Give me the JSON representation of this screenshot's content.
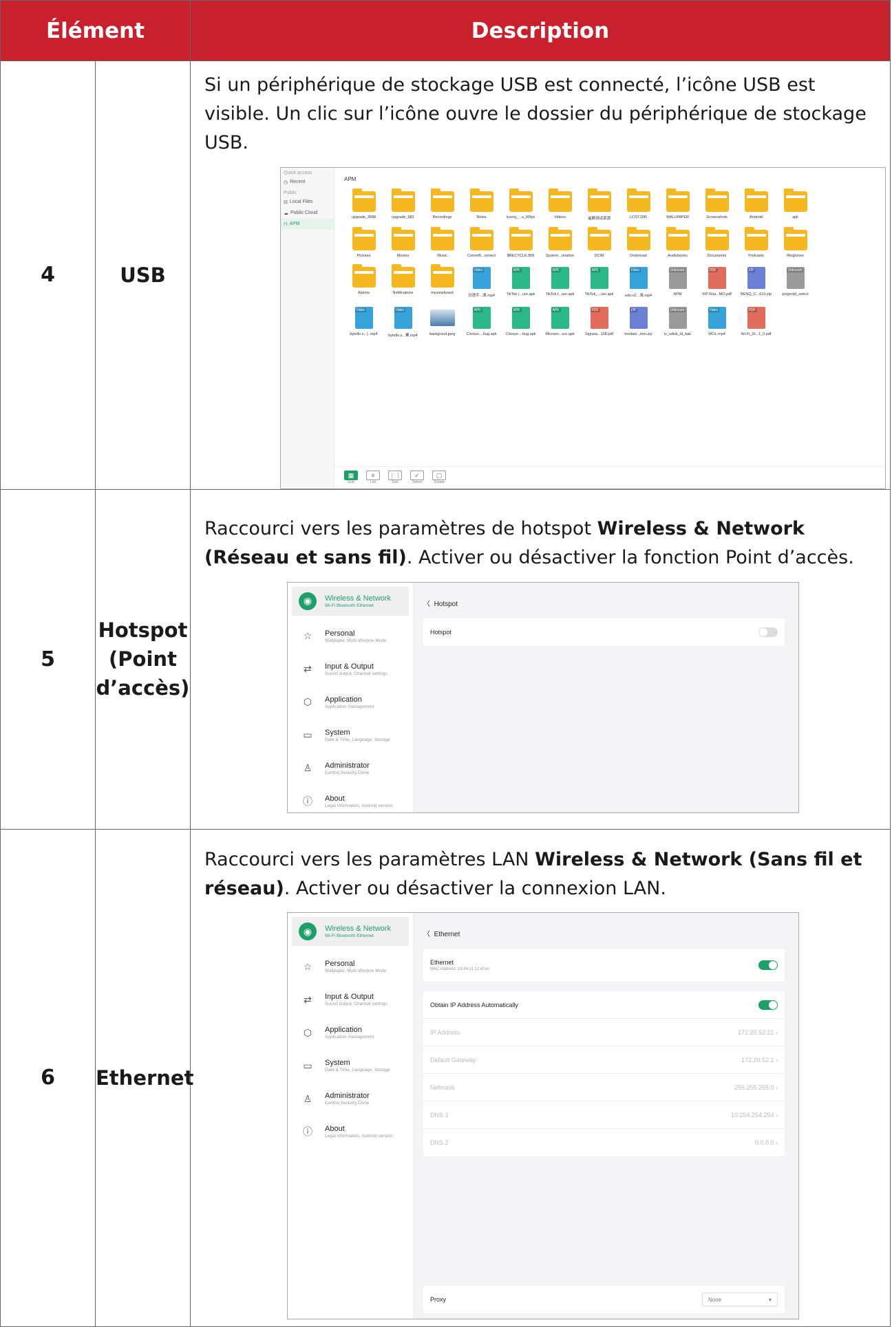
{
  "header": {
    "col1": "Élément",
    "col2": "Description"
  },
  "rows": [
    {
      "num": "4",
      "element": "USB",
      "desc": "Si un périphérique de stockage USB est connecté, l’icône USB est visible. Un clic sur l’icône ouvre le dossier du périphérique de stockage USB."
    },
    {
      "num": "5",
      "element": "Hotspot (Point d’accès)",
      "desc_pre": "Raccourci vers les paramètres de hotspot ",
      "desc_bold": "Wireless & Network (Réseau et sans fil)",
      "desc_post": ". Activer ou désactiver la fonction Point d’accès."
    },
    {
      "num": "6",
      "element": "Ethernet",
      "desc_pre": "Raccourci vers les paramètres LAN ",
      "desc_bold": "Wireless & Network (Sans fil et réseau)",
      "desc_post": ". Activer ou désactiver la connexion LAN."
    }
  ],
  "usb_shot": {
    "sidebar": {
      "quick": "Quick access",
      "recent": "Recent",
      "public": "Public",
      "local": "Local Files",
      "cloud": "Public Cloud",
      "apm": "APM"
    },
    "breadcrumb": "APM",
    "items": [
      {
        "n": "upgrade_3588",
        "t": "folder"
      },
      {
        "n": "upgrade_982",
        "t": "folder"
      },
      {
        "n": "Recordings",
        "t": "folder"
      },
      {
        "n": "Notes",
        "t": "folder"
      },
      {
        "n": "bunny_...s_60fps",
        "t": "folder"
      },
      {
        "n": "Videos",
        "t": "folder"
      },
      {
        "n": "遥屏测试资源",
        "t": "folder"
      },
      {
        "n": "LOST.DIR",
        "t": "folder"
      },
      {
        "n": "WALLPAPER",
        "t": "folder"
      },
      {
        "n": "Screenshots",
        "t": "folder"
      },
      {
        "n": "Android",
        "t": "folder"
      },
      {
        "n": "apk",
        "t": "folder"
      },
      {
        "n": "Pictures",
        "t": "folder"
      },
      {
        "n": "Movies",
        "t": "folder"
      },
      {
        "n": "Music",
        "t": "folder"
      },
      {
        "n": "CommB...onnect",
        "t": "folder"
      },
      {
        "n": "$RECYCLE.BIN",
        "t": "folder"
      },
      {
        "n": "System...rmation",
        "t": "folder"
      },
      {
        "n": "DCIM",
        "t": "folder"
      },
      {
        "n": "Download",
        "t": "folder"
      },
      {
        "n": "Audiobooks",
        "t": "folder"
      },
      {
        "n": "Documents",
        "t": "folder"
      },
      {
        "n": "Podcasts",
        "t": "folder"
      },
      {
        "n": "Ringtones",
        "t": "folder"
      },
      {
        "n": "Alarms",
        "t": "folder"
      },
      {
        "n": "Notifications",
        "t": "folder"
      },
      {
        "n": "myviewboard",
        "t": "folder"
      },
      {
        "n": "日语手...清.mp4",
        "t": "video"
      },
      {
        "n": "TikTok (...ure.apk",
        "t": "apk"
      },
      {
        "n": "TikTok f...ure.apk",
        "t": "apk"
      },
      {
        "n": "TikTok_...ure.apk",
        "t": "apk"
      },
      {
        "n": "edu-v2...清.mp4",
        "t": "video"
      },
      {
        "n": "APM",
        "t": "unk"
      },
      {
        "n": "IFP Roa...MO.pdf",
        "t": "pdf"
      },
      {
        "n": "BENQ_C...610.zip",
        "t": "zip"
      },
      {
        "n": "projectid_select",
        "t": "unk"
      },
      {
        "n": "bytello s...) .mp4",
        "t": "video"
      },
      {
        "n": "bytello s...累.mp4",
        "t": "video"
      },
      {
        "n": "backgroud.jpeg",
        "t": "img"
      },
      {
        "n": "Choruo-...bug.apk",
        "t": "apk"
      },
      {
        "n": "Choruo-...bug.apk",
        "t": "apk"
      },
      {
        "n": "Microso...ure.apk",
        "t": "apk"
      },
      {
        "n": "Signwa...108.pdf",
        "t": "pdf"
      },
      {
        "n": "bootani...tion.zip",
        "t": "zip"
      },
      {
        "n": "lv_udisk_id_bak",
        "t": "unk"
      },
      {
        "n": "WOL.mp4",
        "t": "video"
      },
      {
        "n": "Wi-Fi_Di...1_0.pdf",
        "t": "pdf"
      }
    ],
    "toolbar": [
      "Grid",
      "List",
      "Sort",
      "Select",
      "Create"
    ]
  },
  "settings": {
    "menu": [
      {
        "t": "Wireless & Network",
        "s": "Wi-Fi Bluetooth Ethernet",
        "icon": "wifi-icon",
        "g": "◉"
      },
      {
        "t": "Personal",
        "s": "Wallpaper, Multi-Window Mode",
        "icon": "star-icon",
        "g": "☆"
      },
      {
        "t": "Input & Output",
        "s": "Sound output, Channel settings",
        "icon": "swap-icon",
        "g": "⇄"
      },
      {
        "t": "Application",
        "s": "Application management",
        "icon": "cube-icon",
        "g": "⬡"
      },
      {
        "t": "System",
        "s": "Date & Time, Language, Storage",
        "icon": "monitor-icon",
        "g": "▭"
      },
      {
        "t": "Administrator",
        "s": "Control,Security,Clone",
        "icon": "user-icon",
        "g": "♙"
      },
      {
        "t": "About",
        "s": "Legal information, Android version",
        "icon": "info-icon",
        "g": "ⓘ"
      }
    ],
    "hotspot": {
      "back": "Hotspot",
      "row": "Hotspot"
    },
    "ethernet": {
      "back": "Ethernet",
      "eth": "Ethernet",
      "mac": "MAC Address: 18:84:c1:12:ef:ec",
      "obtain": "Obtain IP Address Automatically",
      "fields": [
        {
          "k": "IP Address",
          "v": "172.20.52.21"
        },
        {
          "k": "Default Gateway",
          "v": "172.20.52.1"
        },
        {
          "k": "Netmask",
          "v": "255.255.255.0"
        },
        {
          "k": "DNS 1",
          "v": "10.254.254.254"
        },
        {
          "k": "DNS 2",
          "v": "0.0.0.0"
        }
      ],
      "proxy": "Proxy",
      "proxy_val": "None"
    }
  }
}
